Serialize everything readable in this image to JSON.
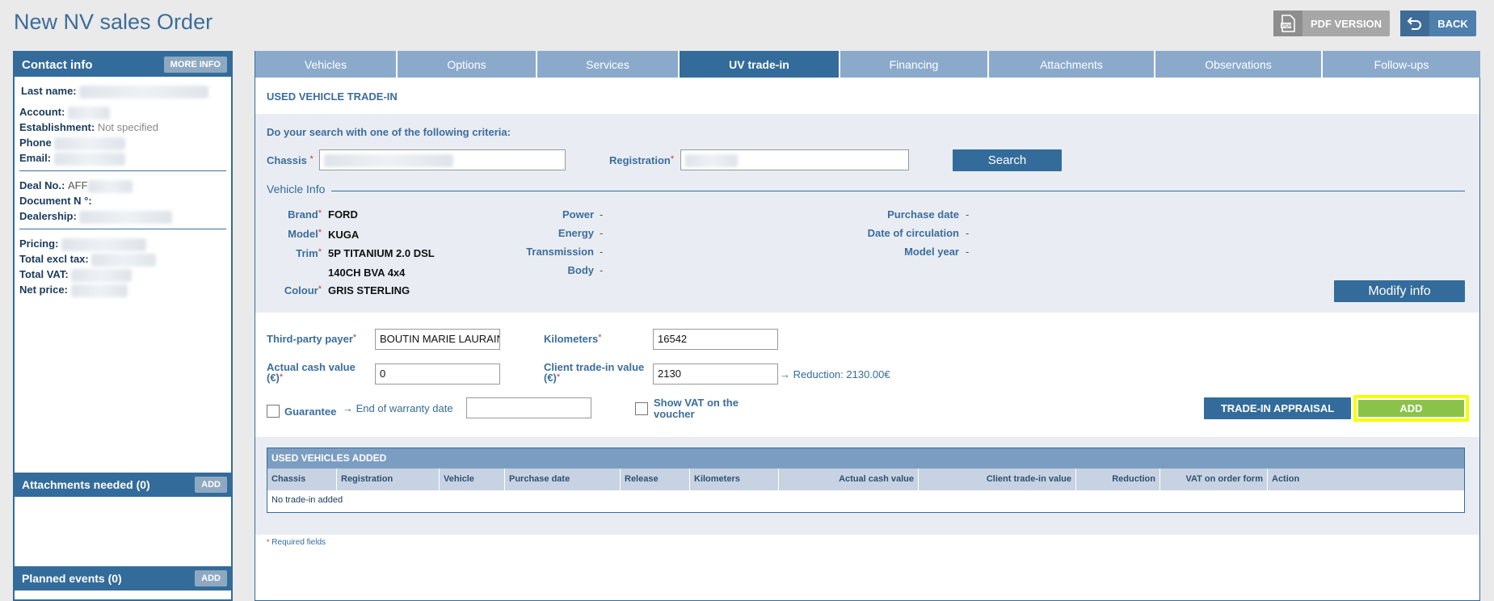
{
  "page": {
    "title": "New NV sales Order",
    "pdf_label": "PDF VERSION",
    "back_label": "BACK"
  },
  "contact": {
    "title": "Contact info",
    "more_info": "MORE INFO",
    "last_name_label": "Last name:",
    "account_label": "Account:",
    "establishment_label": "Establishment:",
    "establishment_value": "Not specified",
    "phone_label": "Phone",
    "email_label": "Email:",
    "deal_label": "Deal No.:",
    "deal_prefix": "AFF",
    "document_label": "Document N °:",
    "dealership_label": "Dealership:",
    "pricing_label": "Pricing:",
    "excl_tax_label": "Total excl tax:",
    "vat_label": "Total VAT:",
    "net_price_label": "Net price:"
  },
  "attachments": {
    "title": "Attachments needed (0)",
    "add": "ADD"
  },
  "planned": {
    "title": "Planned events (0)",
    "add": "ADD"
  },
  "tabs": [
    {
      "label": "Vehicles",
      "active": false
    },
    {
      "label": "Options",
      "active": false
    },
    {
      "label": "Services",
      "active": false
    },
    {
      "label": "UV trade-in",
      "active": true
    },
    {
      "label": "Financing",
      "active": false
    },
    {
      "label": "Attachments",
      "active": false
    },
    {
      "label": "Observations",
      "active": false
    },
    {
      "label": "Follow-ups",
      "active": false
    }
  ],
  "tradein": {
    "section_title": "USED VEHICLE TRADE-IN",
    "search_prompt": "Do your search with one of the following criteria:",
    "chassis_label": "Chassis",
    "registration_label": "Registration",
    "search_btn": "Search",
    "vehicle_info_title": "Vehicle Info",
    "brand_label": "Brand",
    "brand": "FORD",
    "model_label": "Model",
    "model": "KUGA",
    "trim_label": "Trim",
    "trim_line1": "5P TITANIUM 2.0 DSL",
    "trim_line2": "140CH BVA 4x4",
    "colour_label": "Colour",
    "colour": "GRIS STERLING",
    "power_label": "Power",
    "energy_label": "Energy",
    "transmission_label": "Transmission",
    "body_label": "Body",
    "purchase_date_label": "Purchase date",
    "circulation_label": "Date of circulation",
    "model_year_label": "Model year",
    "dash": "-",
    "modify_btn": "Modify info",
    "third_party_label": "Third-party payer",
    "third_party_value": "BOUTIN MARIE LAURAINE",
    "km_label": "Kilometers",
    "km_value": "16542",
    "acv_label_1": "Actual cash value",
    "acv_label_2": "(€)",
    "acv_value": "0",
    "client_label_1": "Client trade-in value",
    "client_label_2": "(€)",
    "client_value": "2130",
    "reduction_text": "→ Reduction: 2130.00€",
    "guarantee_label": "Guarantee",
    "warranty_label": "→ End of warranty date",
    "show_vat_1": "Show VAT on the",
    "show_vat_2": "voucher",
    "appraisal_btn": "TRADE-IN APPRAISAL",
    "add_btn": "ADD",
    "required_note": "Required fields",
    "required_star": "*"
  },
  "uv_table": {
    "title": "USED VEHICLES ADDED",
    "columns": [
      "Chassis",
      "Registration",
      "Vehicle",
      "Purchase date",
      "Release",
      "Kilometers",
      "Actual cash value",
      "Client trade-in value",
      "Reduction",
      "VAT on order form",
      "Action"
    ],
    "empty": "No trade-in added"
  },
  "colors": {
    "primary": "#336c9a",
    "tab": "#8baacb",
    "add_green": "#8bc34a",
    "highlight": "#f5ff00"
  }
}
